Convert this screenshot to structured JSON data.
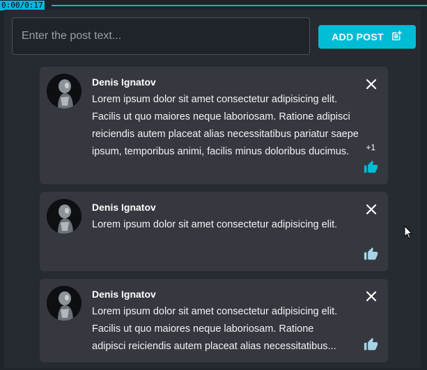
{
  "player": {
    "timecode": "0:00/0:17"
  },
  "composer": {
    "placeholder": "Enter the post text...",
    "add_label": "ADD POST",
    "add_icon": "post-add-icon"
  },
  "colors": {
    "accent": "#00bcd4",
    "background": "#1f232a",
    "card": "#363840",
    "like_liked": "#00bcd4",
    "like_unliked": "#a6d4e6"
  },
  "posts": [
    {
      "author": "Denis Ignatov",
      "text": "Lorem ipsum dolor sit amet consectetur adipisicing elit. Facilis ut quo maiores neque laboriosam. Ratione adipisci reiciendis autem placeat alias necessitatibus pariatur saepe ipsum, temporibus animi, facilis minus doloribus ducimus.",
      "like_count": "+1",
      "liked": true
    },
    {
      "author": "Denis Ignatov",
      "text": "Lorem ipsum dolor sit amet consectetur adipisicing elit.",
      "like_count": "",
      "liked": false
    },
    {
      "author": "Denis Ignatov",
      "text_line1": "Lorem ipsum dolor sit amet consectetur adipisicing elit.",
      "text_line2": "Facilis ut quo maiores neque laboriosam. Ratione",
      "text_line3": "adipisci reiciendis autem placeat alias necessitatibus...",
      "like_count": "",
      "liked": false
    }
  ]
}
